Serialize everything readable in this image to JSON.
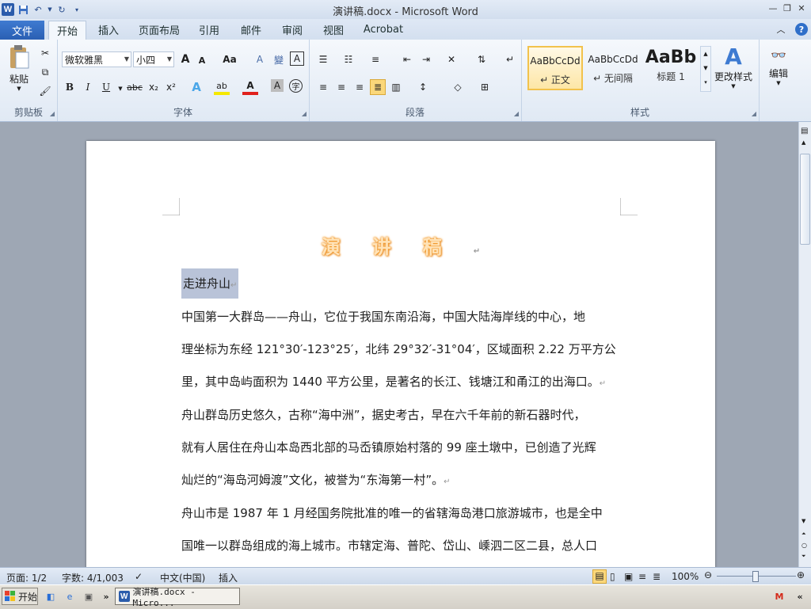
{
  "window": {
    "title": "演讲稿.docx  -  Microsoft Word",
    "app_icon": "W",
    "controls": [
      "minimize-icon",
      "restore-icon",
      "close-icon"
    ]
  },
  "tabs": {
    "file": "文件",
    "items": [
      "开始",
      "插入",
      "页面布局",
      "引用",
      "邮件",
      "审阅",
      "视图",
      "Acrobat"
    ],
    "active": "开始"
  },
  "ribbon": {
    "clipboard": {
      "paste": "粘贴",
      "label": "剪贴板"
    },
    "font": {
      "family": "微软雅黑",
      "size": "小四",
      "label": "字体",
      "glyphs": {
        "grow": "A",
        "shrink": "A",
        "case": "Aa",
        "clear": "A",
        "bold": "B",
        "italic": "I",
        "underline": "U",
        "strike": "abc",
        "sub": "x₂",
        "sup": "x²",
        "effects": "A",
        "highlight": "ab",
        "color": "A",
        "charshade": "A",
        "enclose": "字"
      }
    },
    "paragraph": {
      "label": "段落"
    },
    "styles": {
      "label": "样式",
      "items": [
        {
          "sample": "AaBbCcDd",
          "name": "↵ 正文"
        },
        {
          "sample": "AaBbCcDd",
          "name": "↵ 无间隔"
        },
        {
          "sample": "AaBb",
          "name": "标题 1"
        }
      ],
      "change": "更改样式"
    },
    "editing": {
      "label": "编辑"
    }
  },
  "document": {
    "title": "演讲稿",
    "title_chars": [
      "演",
      "讲",
      "稿"
    ],
    "heading": "走进舟山",
    "para_mark": "↵",
    "lines": [
      "中国第一大群岛——舟山，它位于我国东南沿海，中国大陆海岸线的中心，地",
      "理坐标为东经 121°30′-123°25′，北纬 29°32′-31°04′，区域面积 2.22 万平方公",
      "里，其中岛屿面积为 1440 平方公里，是著名的长江、钱塘江和甬江的出海口。",
      "舟山群岛历史悠久，古称“海中洲”，据史考古，早在六千年前的新石器时代，",
      "就有人居住在舟山本岛西北部的马岙镇原始村落的 99 座土墩中，已创造了光辉",
      "灿烂的“海岛河姆渡”文化，被誉为“东海第一村”。",
      "舟山市是 1987 年 1 月经国务院批准的唯一的省辖海岛港口旅游城市，也是全中",
      "国唯一以群岛组成的海上城市。市辖定海、普陀、岱山、嵊泗二区二县，总人口"
    ]
  },
  "statusbar": {
    "page": "页面: 1/2",
    "words": "字数: 4/1,003",
    "language": "中文(中国)",
    "mode": "插入",
    "zoom": "100%",
    "zoom_fraction": 0.5
  },
  "taskbar": {
    "start": "开始",
    "task": "演讲稿.docx - Micro..."
  }
}
